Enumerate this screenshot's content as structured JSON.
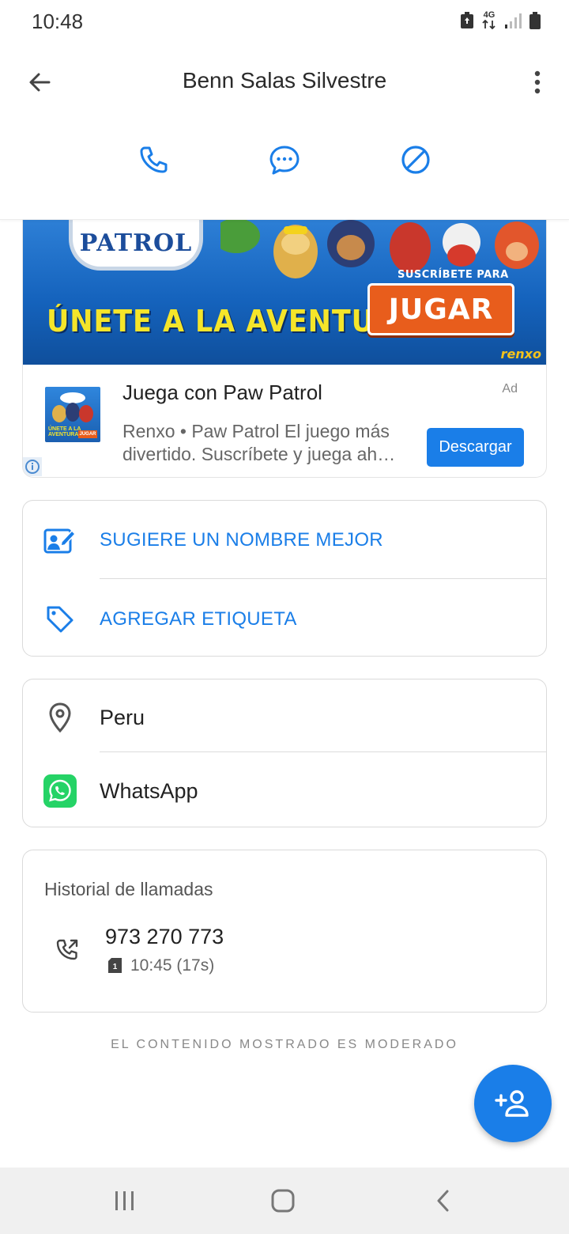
{
  "status_bar": {
    "time": "10:48",
    "network_label": "4G"
  },
  "header": {
    "title": "Benn Salas Silvestre"
  },
  "ad": {
    "banner": {
      "logo_text": "PATROL",
      "slogan": "ÚNETE  A LA AVENTURA",
      "cta_top": "SUSCRÍBETE PARA",
      "cta": "JUGAR",
      "brand": "renxo"
    },
    "thumb": {
      "line1": "ÚNETE A LA",
      "line2": "AVENTURA",
      "cta": "JUGAR"
    },
    "title": "Juega con Paw Patrol",
    "label": "Ad",
    "desc_line1": "Renxo • Paw Patrol El juego más",
    "desc_line2": "divertido. Suscríbete y juega ah…",
    "button": "Descargar"
  },
  "actions_card": {
    "suggest_name": "SUGIERE UN NOMBRE MEJOR",
    "add_tag": "AGREGAR ETIQUETA"
  },
  "info_card": {
    "location": "Peru",
    "app": "WhatsApp"
  },
  "history": {
    "title": "Historial de llamadas",
    "number": "973 270 773",
    "time": "10:45 (17s)"
  },
  "footer_note": "EL CONTENIDO MOSTRADO ES MODERADO",
  "colors": {
    "accent": "#1a7ee8",
    "whatsapp": "#25d366"
  }
}
